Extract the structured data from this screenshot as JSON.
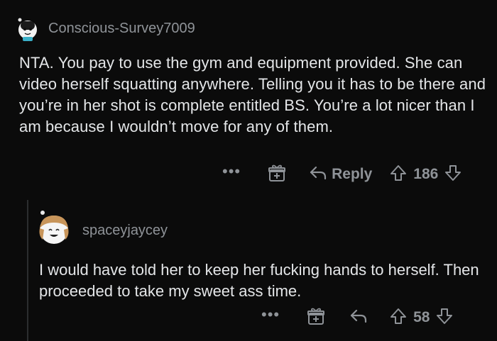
{
  "comments": [
    {
      "username": "Conscious-Survey7009",
      "body": "NTA. You pay to use the gym and equipment provided. She can video herself squatting anywhere. Telling you it has to be there and you’re in her shot is complete entitled BS. You’re a lot nicer than I am because I wouldn’t move for any of them.",
      "more_label": "•••",
      "reply_label": "Reply",
      "score": "186"
    },
    {
      "username": "spaceyjaycey",
      "body": "I would have told her to keep her fucking hands to herself. Then proceeded to take my sweet ass time.",
      "more_label": "•••",
      "score": "58"
    }
  ],
  "icons": {
    "award": "gift-award-icon",
    "reply": "reply-arrow-icon",
    "upvote": "upvote-arrow-icon",
    "downvote": "downvote-arrow-icon",
    "more": "more-dots-icon"
  },
  "colors": {
    "background": "#0b0b0b",
    "text": "#e4e6e8",
    "muted": "#8f9398",
    "thread_line": "#2b2d2f"
  }
}
